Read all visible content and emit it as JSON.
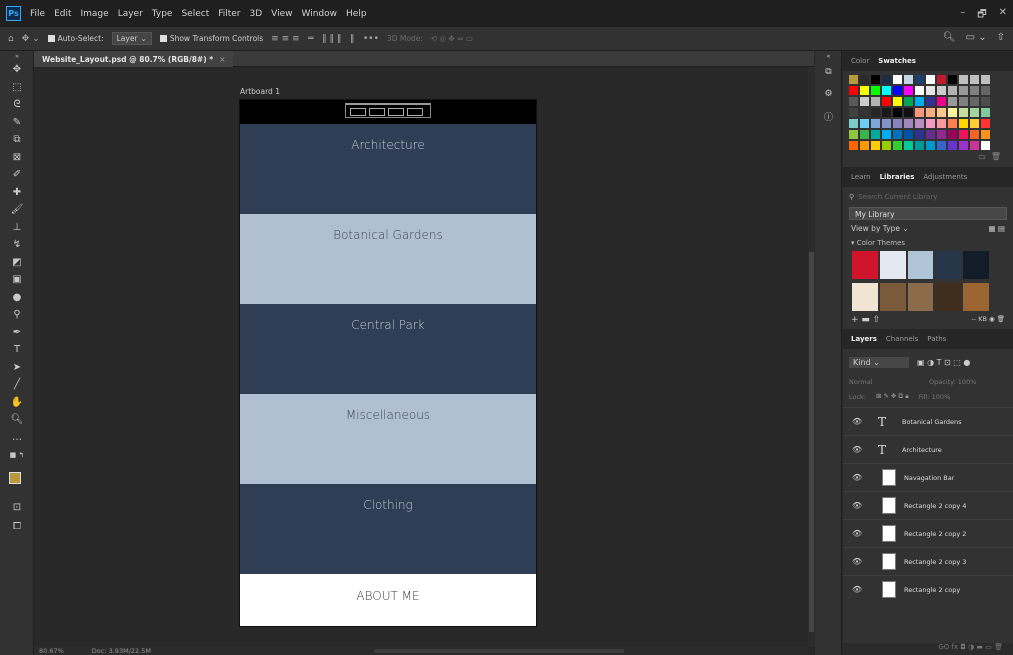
{
  "app": {
    "logo": "Ps"
  },
  "menu": [
    "File",
    "Edit",
    "Image",
    "Layer",
    "Type",
    "Select",
    "Filter",
    "3D",
    "View",
    "Window",
    "Help"
  ],
  "window_controls": [
    "–",
    "🗗",
    "✕"
  ],
  "options": {
    "auto_select_label": "Auto-Select:",
    "auto_select_value": "Layer",
    "transform_label": "Show Transform Controls",
    "mode_3d": "3D Mode:"
  },
  "document": {
    "tab_title": "Website_Layout.psd @ 80.7% (RGB/8#) *",
    "tab_close": "×",
    "artboard_label": "Artboard 1"
  },
  "sections": [
    {
      "label": "Architecture",
      "style": "dark"
    },
    {
      "label": "Botanical Gardens",
      "style": "light"
    },
    {
      "label": "Central Park",
      "style": "dark"
    },
    {
      "label": "Miscellaneous",
      "style": "light"
    },
    {
      "label": "Clothing",
      "style": "dark"
    },
    {
      "label": "ABOUT ME",
      "style": "white"
    }
  ],
  "status": {
    "zoom": "80.67%",
    "doc": "Doc: 3.93M/22.5M"
  },
  "colors": {
    "fg": "#b89a3e",
    "bg": "#ffffff",
    "dark_section": "#2f3e55",
    "light_section": "#b0bfd1"
  },
  "panels": {
    "color_tabs": [
      "Color",
      "Swatches"
    ],
    "lib_tabs": [
      "Learn",
      "Libraries",
      "Adjustments"
    ],
    "lib_search_placeholder": "Search Current Library",
    "lib_selected": "My Library",
    "view_by": "View by Type",
    "color_themes_label": "Color Themes",
    "themes": [
      [
        "#d0142c",
        "#e4e9f1",
        "#b0c4d8",
        "#263548",
        "#131d29"
      ],
      [
        "#f1e4d2",
        "#7a5a3a",
        "#8b6b49",
        "#3f2e1e",
        "#9a6530"
      ]
    ],
    "kb": "-- KB",
    "layers_tabs": [
      "Layers",
      "Channels",
      "Paths"
    ],
    "layer_filter": "Kind",
    "blend_mode": "Normal",
    "opacity": "Opacity: 100%",
    "lock": "Lock:",
    "fill": "Fill: 100%",
    "layers": [
      {
        "name": "Botanical Gardens",
        "kind": "text"
      },
      {
        "name": "Architecture",
        "kind": "text"
      },
      {
        "name": "Navagation Bar",
        "kind": "shape"
      },
      {
        "name": "Rectangle 2 copy 4",
        "kind": "shape"
      },
      {
        "name": "Rectangle 2 copy 2",
        "kind": "shape"
      },
      {
        "name": "Rectangle 2 copy 3",
        "kind": "shape"
      },
      {
        "name": "Rectangle 2 copy",
        "kind": "shape"
      }
    ],
    "swatches": [
      [
        "#b89a3e",
        "#2b2b2b",
        "#000000",
        "#1d2b45",
        "#ffffff",
        "#c5d5e8",
        "#1e3f6e",
        "#ffffff",
        "#c01a2c",
        "#000000",
        "#c0c0c0",
        "#c0c0c0",
        "#c0c0c0"
      ],
      [
        "#ff0000",
        "#ffff00",
        "#00ff00",
        "#00ffff",
        "#0000ff",
        "#ff00ff",
        "#ffffff",
        "#e6e6e6",
        "#cccccc",
        "#b3b3b3",
        "#999999",
        "#808080",
        "#666666"
      ],
      [
        "#595959",
        "#cccccc",
        "#b3b3b3",
        "#ff0000",
        "#ffff00",
        "#00a651",
        "#00aeef",
        "#2e3192",
        "#ec008c",
        "#999999",
        "#808080",
        "#666666",
        "#4d4d4d"
      ],
      [
        "#404040",
        "#333333",
        "#262626",
        "#1a1a1a",
        "#000000",
        "#111111",
        "#f7977a",
        "#f9ad81",
        "#fdc68a",
        "#fff79a",
        "#c4df9b",
        "#a3d39c",
        "#82ca9d"
      ],
      [
        "#7bcdc8",
        "#6ecff6",
        "#7ea7d8",
        "#8493ca",
        "#8882be",
        "#a187be",
        "#bc8dbf",
        "#f49ac2",
        "#f6989d",
        "#ff7f50",
        "#ffd700",
        "#ffcc33",
        "#ff3333"
      ],
      [
        "#8dc63f",
        "#39b54a",
        "#00a99d",
        "#00aeef",
        "#0072bc",
        "#0054a6",
        "#2e3192",
        "#662d91",
        "#92278f",
        "#9e005d",
        "#ed145b",
        "#f26522",
        "#f7941d"
      ],
      [
        "#ff6600",
        "#ff9900",
        "#ffcc00",
        "#99cc00",
        "#33cc33",
        "#00cc99",
        "#009999",
        "#0099cc",
        "#3366cc",
        "#6633cc",
        "#9933cc",
        "#cc3399",
        "#ffffff"
      ]
    ]
  }
}
